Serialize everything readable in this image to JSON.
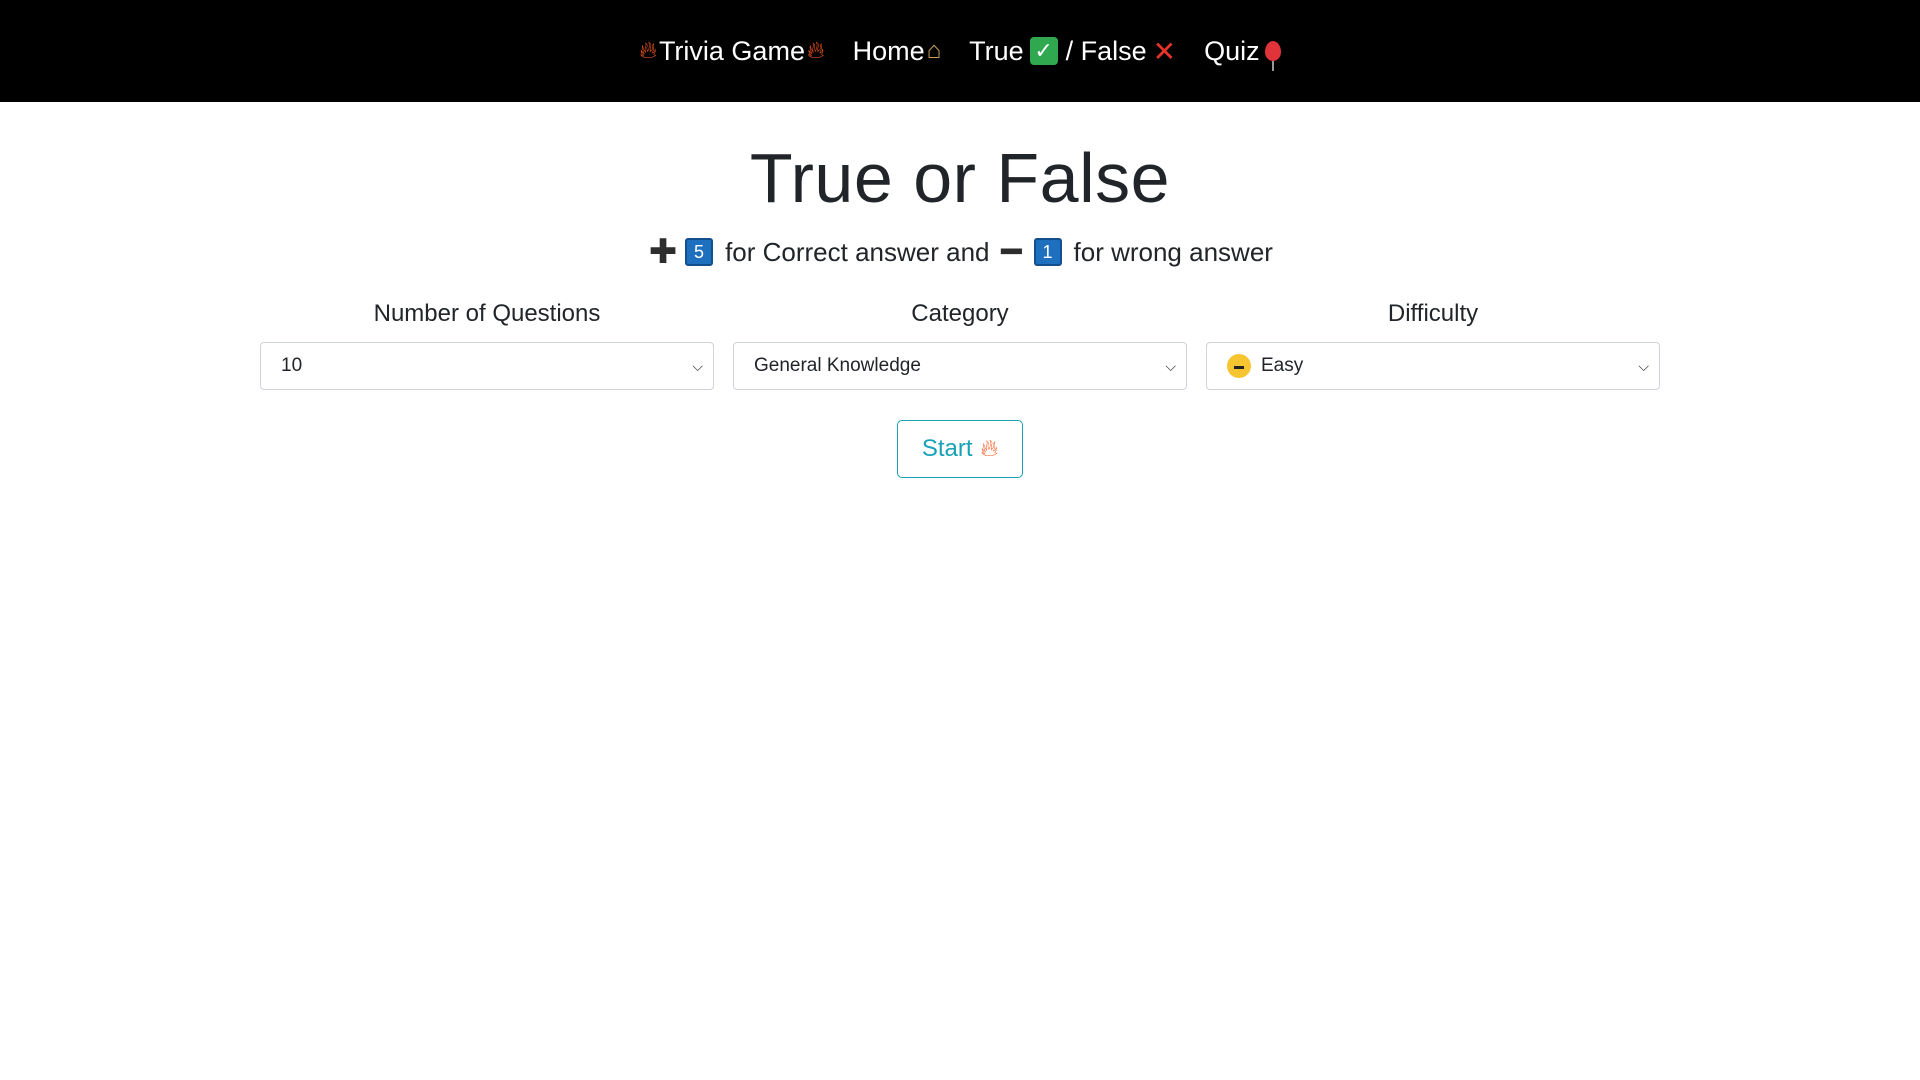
{
  "navbar": {
    "brand": "Trivia Game",
    "brand_icon": "fire-icon",
    "items": [
      {
        "label": "Home",
        "icon": "house-icon"
      },
      {
        "label": "True",
        "icon": "check-mark-icon"
      },
      {
        "label": "/ False",
        "icon": "cross-mark-icon"
      },
      {
        "label": "Quiz",
        "icon": "balloon-icon"
      }
    ]
  },
  "main": {
    "title": "True or False",
    "scoring": {
      "correct_points": "5",
      "correct_text": "for Correct answer and",
      "wrong_points": "1",
      "wrong_text": "for wrong answer"
    },
    "fields": {
      "questions": {
        "label": "Number of Questions",
        "value": "10"
      },
      "category": {
        "label": "Category",
        "value": "General Knowledge"
      },
      "difficulty": {
        "label": "Difficulty",
        "value": "Easy",
        "icon": "smiling-face-with-sunglasses-icon"
      }
    },
    "start_button": {
      "label": "Start",
      "icon": "fire-icon"
    }
  },
  "colors": {
    "navbar_bg": "#000000",
    "accent": "#17a2b8",
    "badge_blue": "#1f6fbf"
  }
}
